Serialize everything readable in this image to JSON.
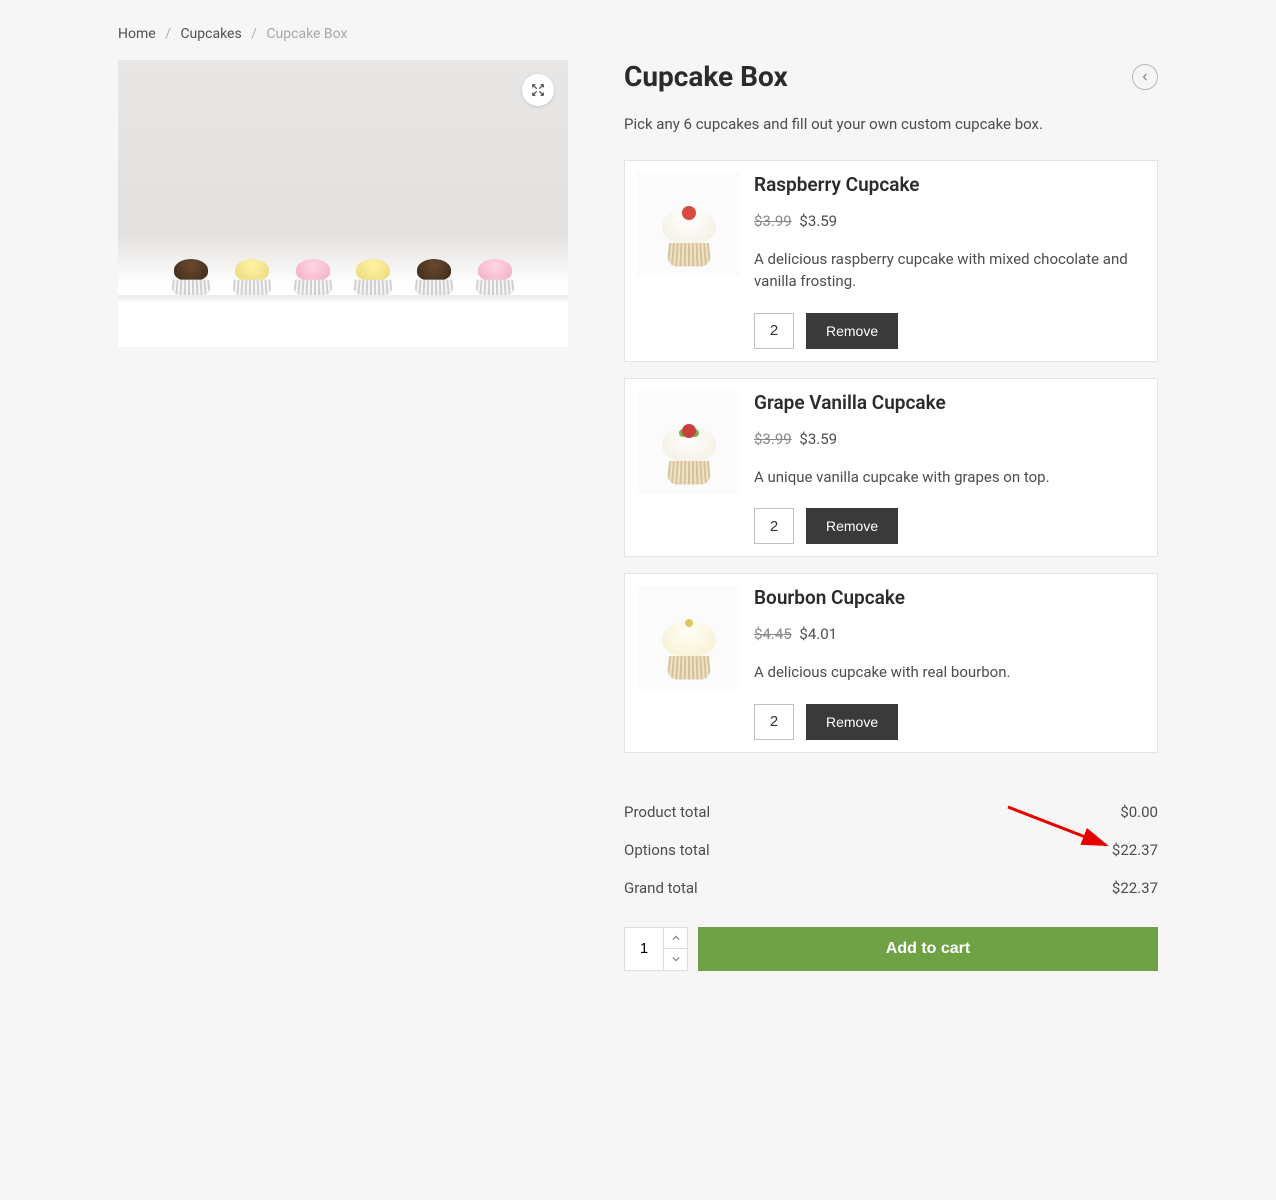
{
  "breadcrumb": {
    "home": "Home",
    "category": "Cupcakes",
    "current": "Cupcake Box"
  },
  "product": {
    "title": "Cupcake Box",
    "description": "Pick any 6 cupcakes and fill out your own custom cupcake box."
  },
  "options": [
    {
      "name": "Raspberry Cupcake",
      "price_old": "$3.99",
      "price_new": "$3.59",
      "description": "A delicious raspberry cupcake with mixed chocolate and vanilla frosting.",
      "qty": "2",
      "remove_label": "Remove"
    },
    {
      "name": "Grape Vanilla Cupcake",
      "price_old": "$3.99",
      "price_new": "$3.59",
      "description": "A unique vanilla cupcake with grapes on top.",
      "qty": "2",
      "remove_label": "Remove"
    },
    {
      "name": "Bourbon Cupcake",
      "price_old": "$4.45",
      "price_new": "$4.01",
      "description": "A delicious cupcake with real bourbon.",
      "qty": "2",
      "remove_label": "Remove"
    }
  ],
  "totals": {
    "product_label": "Product total",
    "product_value": "$0.00",
    "options_label": "Options total",
    "options_value": "$22.37",
    "grand_label": "Grand total",
    "grand_value": "$22.37"
  },
  "cart": {
    "qty": "1",
    "add_label": "Add to cart"
  }
}
